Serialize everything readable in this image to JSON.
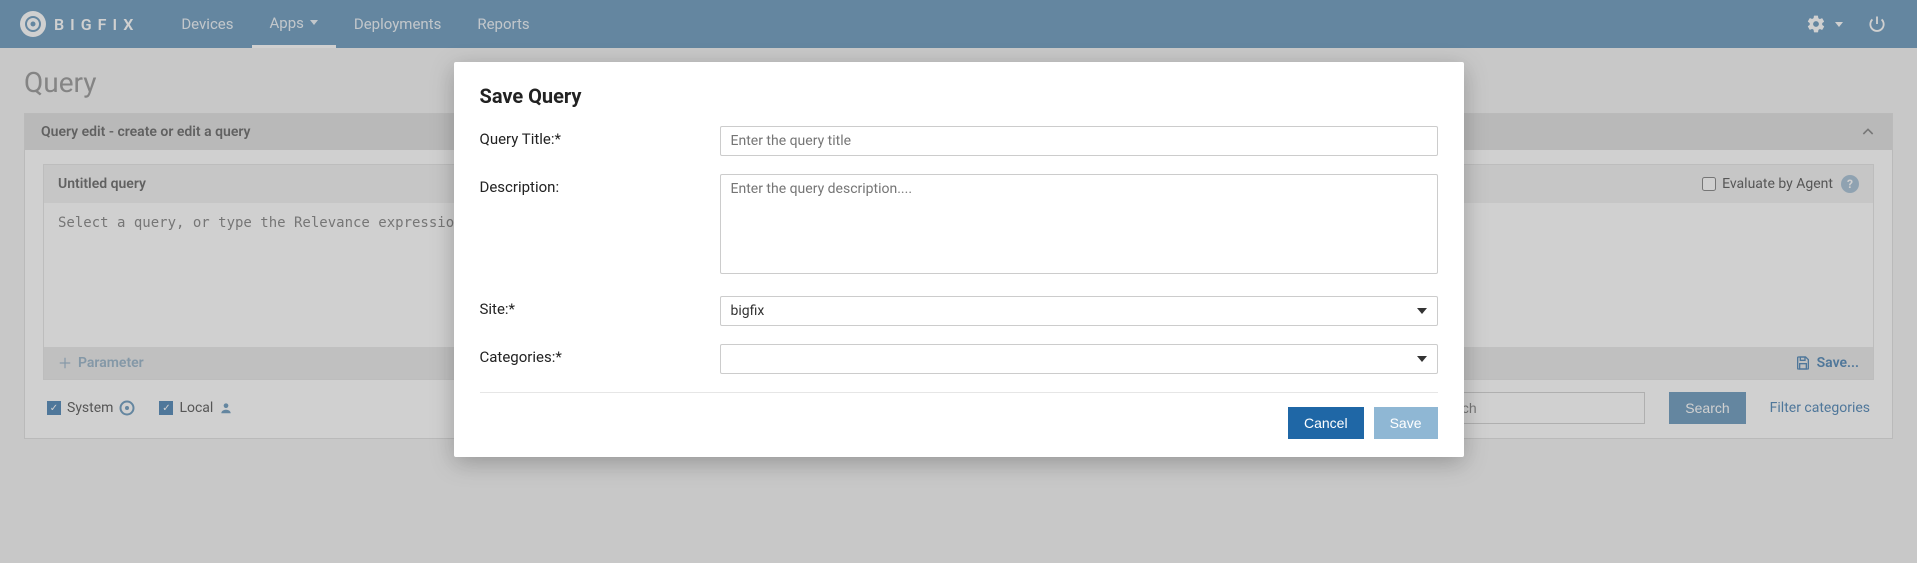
{
  "nav": {
    "brand": "BIGFIX",
    "items": [
      "Devices",
      "Apps",
      "Deployments",
      "Reports"
    ],
    "active_index": 1
  },
  "page": {
    "title": "Query",
    "panel_header": "Query edit - create or edit a query",
    "editor_title": "Untitled query",
    "editor_placeholder": "Select a query, or type the Relevance expression....",
    "evaluate_label": "Evaluate by Agent",
    "parameter_button": "Parameter",
    "save_link": "Save...",
    "filters": {
      "system": "System",
      "local": "Local",
      "search_placeholder": "Search",
      "search_button": "Search",
      "filter_categories": "Filter categories"
    }
  },
  "modal": {
    "title": "Save Query",
    "labels": {
      "query_title": "Query Title:*",
      "description": "Description:",
      "site": "Site:*",
      "categories": "Categories:*"
    },
    "placeholders": {
      "query_title": "Enter the query title",
      "description": "Enter the query description...."
    },
    "values": {
      "query_title": "",
      "description": "",
      "site": "bigfix",
      "categories": ""
    },
    "buttons": {
      "cancel": "Cancel",
      "save": "Save"
    }
  }
}
